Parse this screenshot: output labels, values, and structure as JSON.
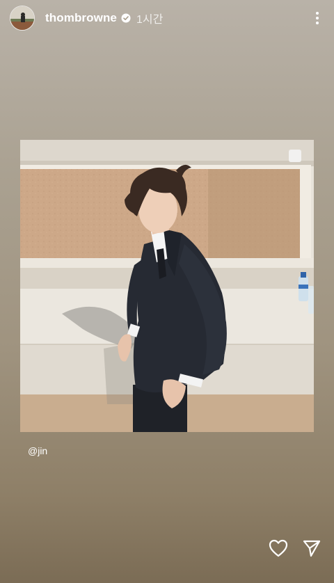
{
  "header": {
    "username": "thombrowne",
    "timestamp": "1시간",
    "avatar_icon": "avatar-photo",
    "verified_icon": "verified-badge-icon",
    "more_icon": "more-vertical-icon"
  },
  "post": {
    "mention": "@jin"
  },
  "actions": {
    "like_icon": "heart-icon",
    "share_icon": "paper-plane-icon"
  },
  "colors": {
    "background_top": "#b9b2a8",
    "background_bottom": "#7b6c55",
    "text": "#ffffff"
  }
}
